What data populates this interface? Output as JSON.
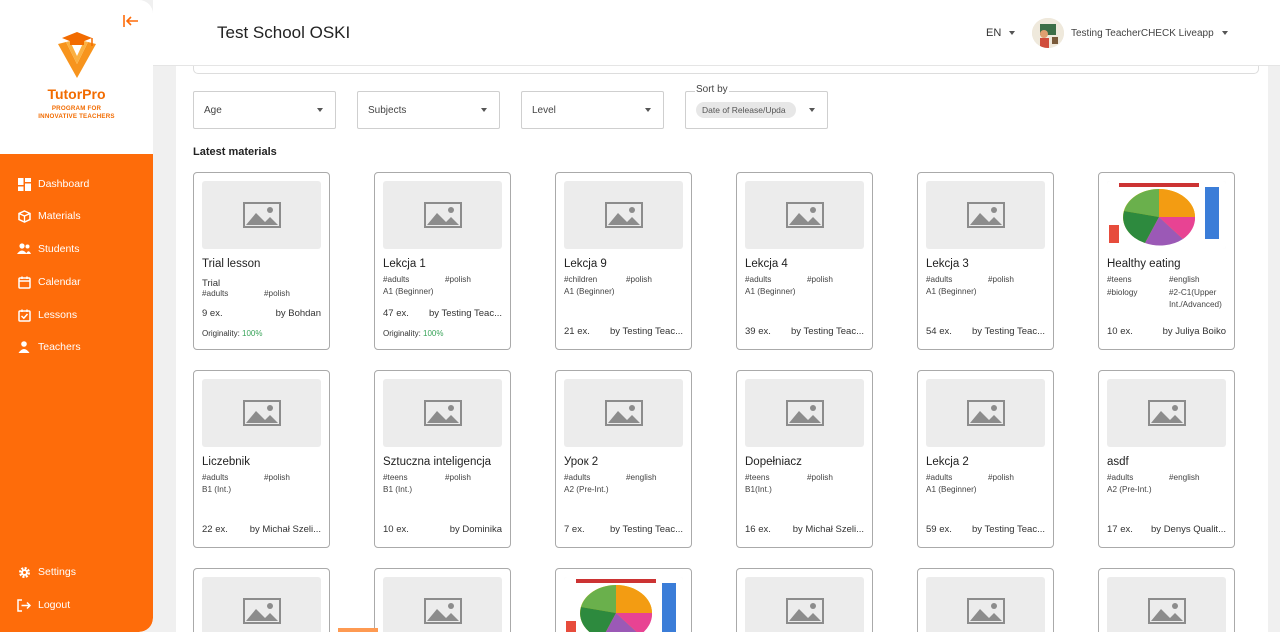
{
  "sidebar": {
    "brand": "TutorPro",
    "tagline1": "PROGRAM FOR",
    "tagline2": "INNOVATIVE TEACHERS",
    "items": [
      {
        "label": "Dashboard",
        "icon": "dashboard-icon"
      },
      {
        "label": "Materials",
        "icon": "materials-icon"
      },
      {
        "label": "Students",
        "icon": "students-icon"
      },
      {
        "label": "Calendar",
        "icon": "calendar-icon"
      },
      {
        "label": "Lessons",
        "icon": "lessons-icon"
      },
      {
        "label": "Teachers",
        "icon": "teachers-icon"
      }
    ],
    "bottom_items": [
      {
        "label": "Settings",
        "icon": "gear-icon"
      },
      {
        "label": "Logout",
        "icon": "logout-icon"
      }
    ],
    "colors": {
      "accent": "#fe6c0a"
    }
  },
  "header": {
    "school": "Test School OSKI",
    "lang": "EN",
    "user": "Testing TeacherCHECK Liveapp"
  },
  "filters": {
    "age": "Age",
    "subjects": "Subjects",
    "level": "Level",
    "sort_label": "Sort by",
    "sort_value": "Date of Release/Upda"
  },
  "section_title": "Latest materials",
  "cards": [
    {
      "title": "Trial lesson",
      "subtitle": "Trial",
      "tags": [
        "#adults",
        "#polish"
      ],
      "level": "",
      "count": "9 ex.",
      "by": "by Bohdan",
      "originality_label": "Originality:",
      "originality": "100%",
      "thumb": "placeholder"
    },
    {
      "title": "Lekcja 1",
      "subtitle": "",
      "tags": [
        "#adults",
        "#polish"
      ],
      "level": "A1 (Beginner)",
      "count": "47 ex.",
      "by": "by Testing Teac...",
      "originality_label": "Originality:",
      "originality": "100%",
      "thumb": "placeholder"
    },
    {
      "title": "Lekcja 9",
      "subtitle": "",
      "tags": [
        "#children",
        "#polish"
      ],
      "level": "A1 (Beginner)",
      "count": "21 ex.",
      "by": "by Testing Teac...",
      "originality_label": "",
      "originality": "",
      "thumb": "placeholder"
    },
    {
      "title": "Lekcja 4",
      "subtitle": "",
      "tags": [
        "#adults",
        "#polish"
      ],
      "level": "A1 (Beginner)",
      "count": "39 ex.",
      "by": "by Testing Teac...",
      "originality_label": "",
      "originality": "",
      "thumb": "placeholder"
    },
    {
      "title": "Lekcja 3",
      "subtitle": "",
      "tags": [
        "#adults",
        "#polish"
      ],
      "level": "A1 (Beginner)",
      "count": "54 ex.",
      "by": "by Testing Teac...",
      "originality_label": "",
      "originality": "",
      "thumb": "placeholder"
    },
    {
      "title": "Healthy eating",
      "subtitle": "",
      "tags": [
        "#teens",
        "#english",
        "#biology",
        "#2-C1(Upper Int./Advanced)"
      ],
      "level": "",
      "count": "10 ex.",
      "by": "by Juliya Boiko",
      "originality_label": "",
      "originality": "",
      "thumb": "food"
    },
    {
      "title": "Liczebnik",
      "subtitle": "",
      "tags": [
        "#adults",
        "#polish"
      ],
      "level": "B1 (Int.)",
      "count": "22 ex.",
      "by": "by Michał Szeli...",
      "originality_label": "",
      "originality": "",
      "thumb": "placeholder"
    },
    {
      "title": "Sztuczna inteligencja",
      "subtitle": "",
      "tags": [
        "#teens",
        "#polish"
      ],
      "level": "B1 (Int.)",
      "count": "10 ex.",
      "by": "by Dominika",
      "originality_label": "",
      "originality": "",
      "thumb": "placeholder"
    },
    {
      "title": "Урок 2",
      "subtitle": "",
      "tags": [
        "#adults",
        "#english"
      ],
      "level": "A2 (Pre-Int.)",
      "count": "7 ex.",
      "by": "by Testing Teac...",
      "originality_label": "",
      "originality": "",
      "thumb": "placeholder"
    },
    {
      "title": "Dopełniacz",
      "subtitle": "",
      "tags": [
        "#teens",
        "#polish"
      ],
      "level": "B1(Int.)",
      "count": "16 ex.",
      "by": "by Michał Szeli...",
      "originality_label": "",
      "originality": "",
      "thumb": "placeholder"
    },
    {
      "title": "Lekcja 2",
      "subtitle": "",
      "tags": [
        "#adults",
        "#polish"
      ],
      "level": "A1 (Beginner)",
      "count": "59 ex.",
      "by": "by Testing Teac...",
      "originality_label": "",
      "originality": "",
      "thumb": "placeholder"
    },
    {
      "title": "asdf",
      "subtitle": "",
      "tags": [
        "#adults",
        "#english"
      ],
      "level": "A2 (Pre-Int.)",
      "count": "17 ex.",
      "by": "by Denys Qualit...",
      "originality_label": "",
      "originality": "",
      "thumb": "placeholder"
    },
    {
      "title": "",
      "subtitle": "",
      "tags": [],
      "level": "",
      "count": "",
      "by": "",
      "originality_label": "",
      "originality": "",
      "thumb": "placeholder"
    },
    {
      "title": "",
      "subtitle": "",
      "tags": [],
      "level": "",
      "count": "",
      "by": "",
      "originality_label": "",
      "originality": "",
      "thumb": "placeholder"
    },
    {
      "title": "",
      "subtitle": "",
      "tags": [],
      "level": "",
      "count": "",
      "by": "",
      "originality_label": "",
      "originality": "",
      "thumb": "food"
    },
    {
      "title": "",
      "subtitle": "",
      "tags": [],
      "level": "",
      "count": "",
      "by": "",
      "originality_label": "",
      "originality": "",
      "thumb": "placeholder"
    },
    {
      "title": "",
      "subtitle": "",
      "tags": [],
      "level": "",
      "count": "",
      "by": "",
      "originality_label": "",
      "originality": "",
      "thumb": "placeholder"
    },
    {
      "title": "",
      "subtitle": "",
      "tags": [],
      "level": "",
      "count": "",
      "by": "",
      "originality_label": "",
      "originality": "",
      "thumb": "placeholder"
    }
  ]
}
